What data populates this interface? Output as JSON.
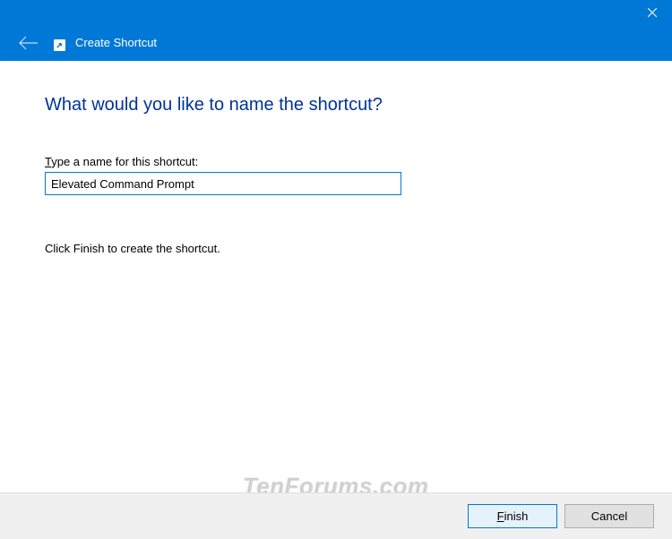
{
  "titlebar": {
    "window_title": "Create Shortcut"
  },
  "content": {
    "heading": "What would you like to name the shortcut?",
    "field_label_prefix": "T",
    "field_label_rest": "ype a name for this shortcut:",
    "name_value": "Elevated Command Prompt",
    "instruction": "Click Finish to create the shortcut."
  },
  "footer": {
    "finish_prefix": "F",
    "finish_rest": "inish",
    "cancel": "Cancel"
  },
  "watermark": "TenForums.com"
}
